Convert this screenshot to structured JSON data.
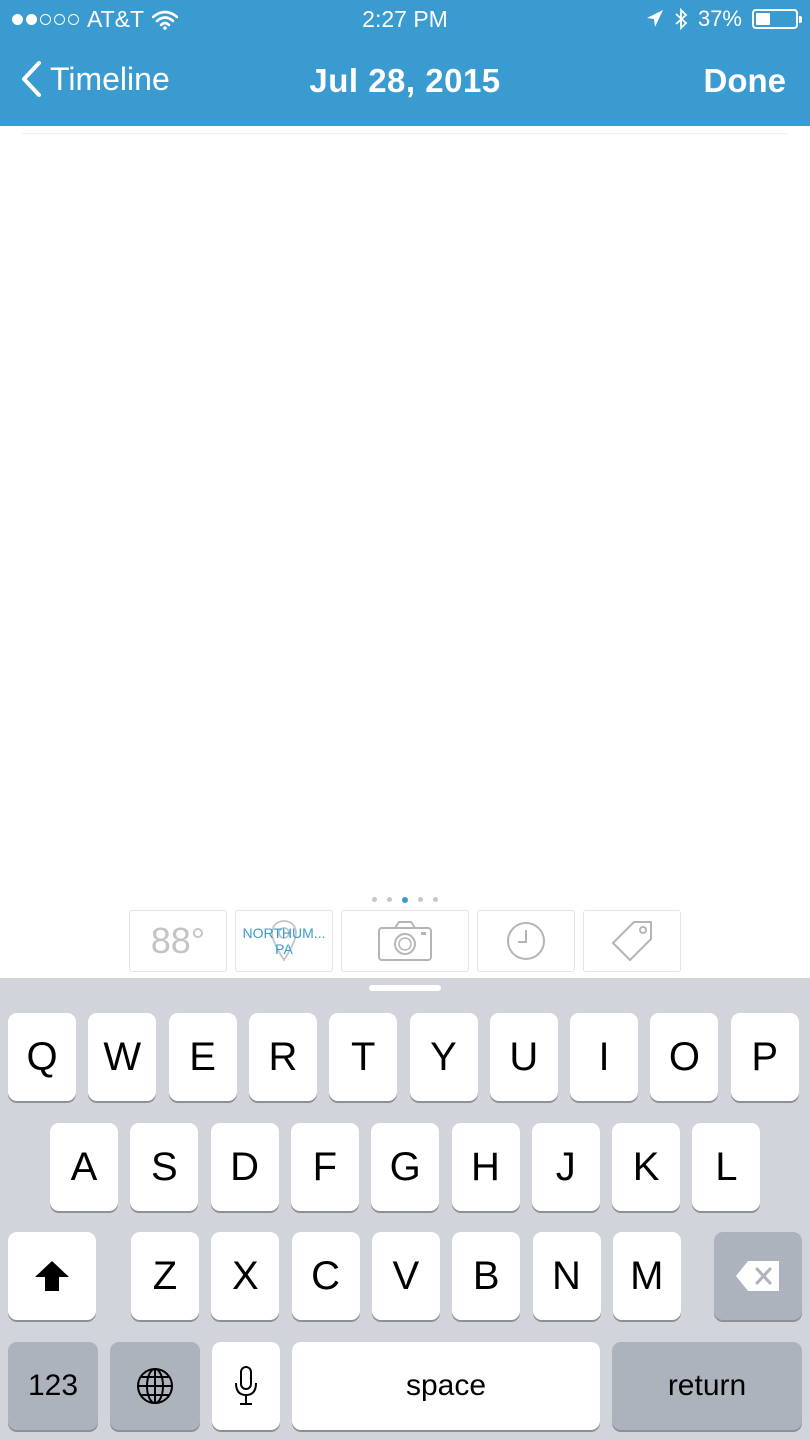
{
  "status_bar": {
    "carrier": "AT&T",
    "time": "2:27 PM",
    "battery": "37%",
    "battery_level": 0.37,
    "signal_bars": 2,
    "signal_total": 5
  },
  "nav": {
    "back_label": "Timeline",
    "title": "Jul 28, 2015",
    "done_label": "Done"
  },
  "toolbar": {
    "weather": "88°",
    "location_line1": "NORTHUM...",
    "location_line2": "PA",
    "page_count": 5,
    "active_page": 2,
    "icons": [
      "weather-icon",
      "location-pin-icon",
      "camera-icon",
      "clock-icon",
      "tag-icon"
    ]
  },
  "keyboard": {
    "row1": [
      "Q",
      "W",
      "E",
      "R",
      "T",
      "Y",
      "U",
      "I",
      "O",
      "P"
    ],
    "row2": [
      "A",
      "S",
      "D",
      "F",
      "G",
      "H",
      "J",
      "K",
      "L"
    ],
    "row3": [
      "Z",
      "X",
      "C",
      "V",
      "B",
      "N",
      "M"
    ],
    "numbers_label": "123",
    "space_label": "space",
    "return_label": "return"
  },
  "colors": {
    "header": "#3a9bd0",
    "keyboard_bg": "#d1d4da",
    "accent": "#3a9bd0"
  }
}
